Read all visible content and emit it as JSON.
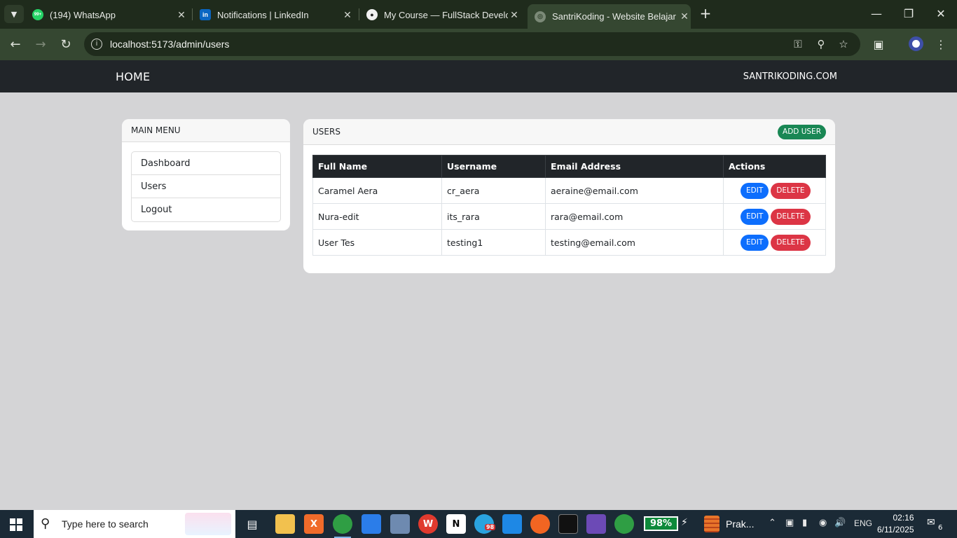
{
  "browser": {
    "tabs": [
      {
        "title": "(194) WhatsApp",
        "icon": "whatsapp-icon"
      },
      {
        "title": "Notifications | LinkedIn",
        "icon": "linkedin-icon"
      },
      {
        "title": "My Course — FullStack Develop",
        "icon": "course-icon"
      },
      {
        "title": "SantriKoding - Website Belajar",
        "icon": "globe-icon",
        "active": true
      }
    ],
    "whatsapp_badge": "99+",
    "url": "localhost:5173/admin/users"
  },
  "navbar": {
    "home": "HOME",
    "brand": "SANTRIKODING.COM"
  },
  "menu": {
    "header": "MAIN MENU",
    "items": [
      "Dashboard",
      "Users",
      "Logout"
    ]
  },
  "users": {
    "header": "USERS",
    "add_label": "ADD USER",
    "columns": [
      "Full Name",
      "Username",
      "Email Address",
      "Actions"
    ],
    "edit_label": "EDIT",
    "delete_label": "DELETE",
    "rows": [
      {
        "full_name": "Caramel Aera",
        "username": "cr_aera",
        "email": "aeraine@email.com"
      },
      {
        "full_name": "Nura-edit",
        "username": "its_rara",
        "email": "rara@email.com"
      },
      {
        "full_name": "User Tes",
        "username": "testing1",
        "email": "testing@email.com"
      }
    ]
  },
  "taskbar": {
    "search_placeholder": "Type here to search",
    "battery": "98%",
    "prak_label": "Prak...",
    "language": "ENG",
    "time": "02:16",
    "date": "6/11/2025",
    "notification_count": "6",
    "telegram_badge": "98"
  },
  "colors": {
    "navbar": "#212529",
    "add_button": "#198754",
    "edit_button": "#0d6efd",
    "delete_button": "#dc3545",
    "chrome_frame": "#1f2b1c",
    "chrome_toolbar": "#354731"
  }
}
